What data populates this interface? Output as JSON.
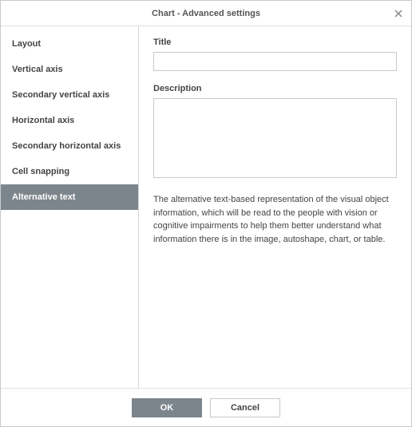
{
  "titlebar": {
    "title": "Chart - Advanced settings"
  },
  "sidebar": {
    "items": [
      {
        "label": "Layout",
        "active": false
      },
      {
        "label": "Vertical axis",
        "active": false
      },
      {
        "label": "Secondary vertical axis",
        "active": false
      },
      {
        "label": "Horizontal axis",
        "active": false
      },
      {
        "label": "Secondary horizontal axis",
        "active": false
      },
      {
        "label": "Cell snapping",
        "active": false
      },
      {
        "label": "Alternative text",
        "active": true
      }
    ]
  },
  "content": {
    "title_label": "Title",
    "title_value": "",
    "description_label": "Description",
    "description_value": "",
    "help_text": "The alternative text-based representation of the visual object information, which will be read to the people with vision or cognitive impairments to help them better understand what information there is in the image, autoshape, chart, or table."
  },
  "footer": {
    "ok_label": "OK",
    "cancel_label": "Cancel"
  }
}
